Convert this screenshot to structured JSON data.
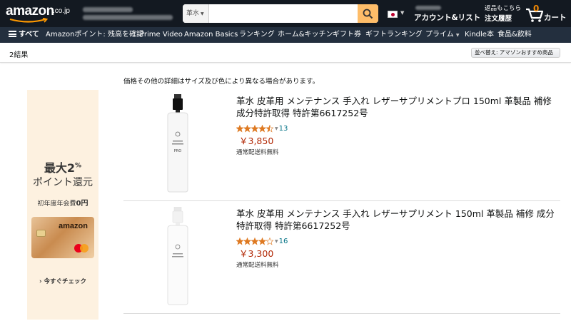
{
  "header": {
    "logo": "amazon",
    "logo_tld": ".co.jp",
    "search_category": "革水",
    "search_value": "",
    "account_label": "アカウント&リスト",
    "orders_line1": "返品もこちら",
    "orders_line2": "注文履歴",
    "cart_count": "0",
    "cart_label": "カート"
  },
  "subnav": {
    "items": [
      {
        "label": "すべて"
      },
      {
        "label": "Amazonポイント: 残高を確認"
      },
      {
        "label": "Prime Video"
      },
      {
        "label": "Amazon Basics"
      },
      {
        "label": "ランキング"
      },
      {
        "label": "ホーム&キッチン"
      },
      {
        "label": "ギフト券"
      },
      {
        "label": "ギフトランキング"
      },
      {
        "label": "プライム"
      },
      {
        "label": "Kindle本"
      },
      {
        "label": "食品&飲料"
      }
    ]
  },
  "results_bar": {
    "count": "2結果",
    "sort_label": "並べ替え: アマゾンおすすめ商品"
  },
  "ad": {
    "headline": "最大2",
    "headline_sup": "%",
    "subline": "ポイント還元",
    "fee_prefix": "初年度年会費",
    "fee_value": "0円",
    "card_brand": "amazon",
    "cta": "今すぐチェック"
  },
  "disclaimer": "価格その他の詳細はサイズ及び色により異なる場合があります。",
  "results": [
    {
      "title": "革水 皮革用 メンテナンス 手入れ レザーサプリメントプロ 150ml 革製品 補修 成分特許取得 特許第6617252号",
      "rating": 4.5,
      "rating_count": "13",
      "price": "￥3,850",
      "shipping": "通常配送料無料",
      "label_text": "PRO"
    },
    {
      "title": "革水 皮革用 メンテナンス 手入れ レザーサプリメント 150ml 革製品 補修 成分特許取得 特許第6617252号",
      "rating": 4.0,
      "rating_count": "16",
      "price": "￥3,300",
      "shipping": "通常配送料無料",
      "label_text": ""
    }
  ],
  "colors": {
    "nav_bg": "#131921",
    "subnav_bg": "#232f3e",
    "search_button": "#febd69",
    "price": "#b12704",
    "link": "#007185",
    "star": "#de7921"
  }
}
